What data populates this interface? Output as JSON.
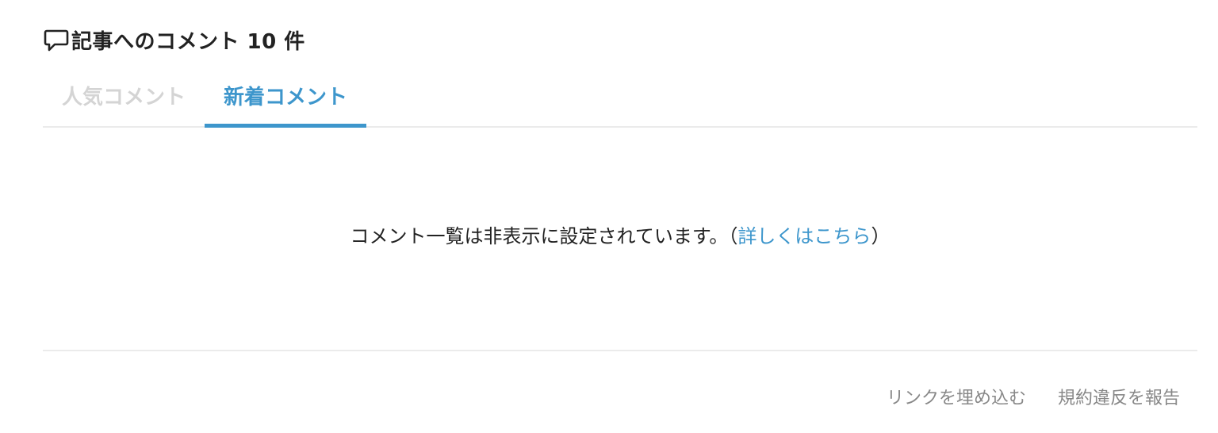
{
  "header": {
    "icon": "speech-bubble-icon",
    "title": "記事へのコメント 10 件"
  },
  "tabs": [
    {
      "label": "人気コメント",
      "active": false
    },
    {
      "label": "新着コメント",
      "active": true
    }
  ],
  "notice": {
    "message": "コメント一覧は非表示に設定されています。",
    "open_paren": "（",
    "link_label": "詳しくはこちら",
    "close_paren": "）"
  },
  "footer": {
    "embed_link": "リンクを埋め込む",
    "report_link": "規約違反を報告"
  },
  "colors": {
    "accent": "#3d96cc",
    "inactive_tab": "#d4d4d4",
    "muted": "#888888",
    "divider": "#ebebeb"
  }
}
